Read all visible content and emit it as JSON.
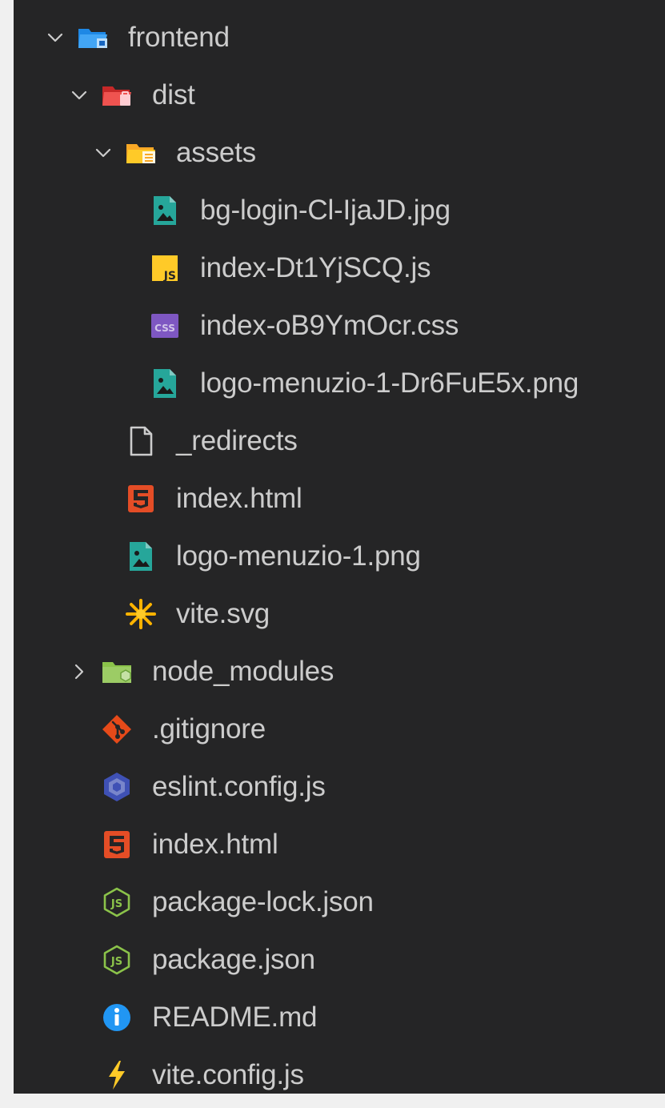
{
  "explorer": {
    "items": [
      {
        "label": "frontend",
        "depth": 0,
        "twisty": "open",
        "icon": "folder-open-blue-icon"
      },
      {
        "label": "dist",
        "depth": 1,
        "twisty": "open",
        "icon": "folder-open-red-icon"
      },
      {
        "label": "assets",
        "depth": 2,
        "twisty": "open",
        "icon": "folder-open-yellow-icon"
      },
      {
        "label": "bg-login-Cl-IjaJD.jpg",
        "depth": 3,
        "twisty": "none",
        "icon": "image-file-icon"
      },
      {
        "label": "index-Dt1YjSCQ.js",
        "depth": 3,
        "twisty": "none",
        "icon": "javascript-file-icon"
      },
      {
        "label": "index-oB9YmOcr.css",
        "depth": 3,
        "twisty": "none",
        "icon": "css-file-icon"
      },
      {
        "label": "logo-menuzio-1-Dr6FuE5x.png",
        "depth": 3,
        "twisty": "none",
        "icon": "image-file-icon"
      },
      {
        "label": "_redirects",
        "depth": 2,
        "twisty": "none",
        "icon": "generic-file-icon"
      },
      {
        "label": "index.html",
        "depth": 2,
        "twisty": "none",
        "icon": "html-file-icon"
      },
      {
        "label": "logo-menuzio-1.png",
        "depth": 2,
        "twisty": "none",
        "icon": "image-file-icon"
      },
      {
        "label": "vite.svg",
        "depth": 2,
        "twisty": "none",
        "icon": "svg-file-icon"
      },
      {
        "label": "node_modules",
        "depth": 1,
        "twisty": "closed",
        "icon": "folder-node-icon"
      },
      {
        "label": ".gitignore",
        "depth": 1,
        "twisty": "none",
        "icon": "git-file-icon"
      },
      {
        "label": "eslint.config.js",
        "depth": 1,
        "twisty": "none",
        "icon": "eslint-file-icon"
      },
      {
        "label": "index.html",
        "depth": 1,
        "twisty": "none",
        "icon": "html-file-icon"
      },
      {
        "label": "package-lock.json",
        "depth": 1,
        "twisty": "none",
        "icon": "nodejs-file-icon"
      },
      {
        "label": "package.json",
        "depth": 1,
        "twisty": "none",
        "icon": "nodejs-file-icon"
      },
      {
        "label": "README.md",
        "depth": 1,
        "twisty": "none",
        "icon": "info-file-icon"
      },
      {
        "label": "vite.config.js",
        "depth": 1,
        "twisty": "none",
        "icon": "vite-file-icon"
      }
    ]
  },
  "colors": {
    "panel_bg": "#252526",
    "page_bg": "#f0f0f0",
    "text": "#cccccc",
    "folder_blue": "#42a5f5",
    "folder_red": "#ef5350",
    "folder_yellow": "#ffca28",
    "image_teal": "#26a69a",
    "js_yellow": "#ffca28",
    "css_purple": "#7e57c2",
    "html_orange": "#e44d26",
    "node_green": "#8bc34a",
    "git_orange": "#e64a19",
    "eslint_blue": "#3f51b5",
    "info_blue": "#2196f3",
    "vite_yellow": "#ffca28"
  }
}
